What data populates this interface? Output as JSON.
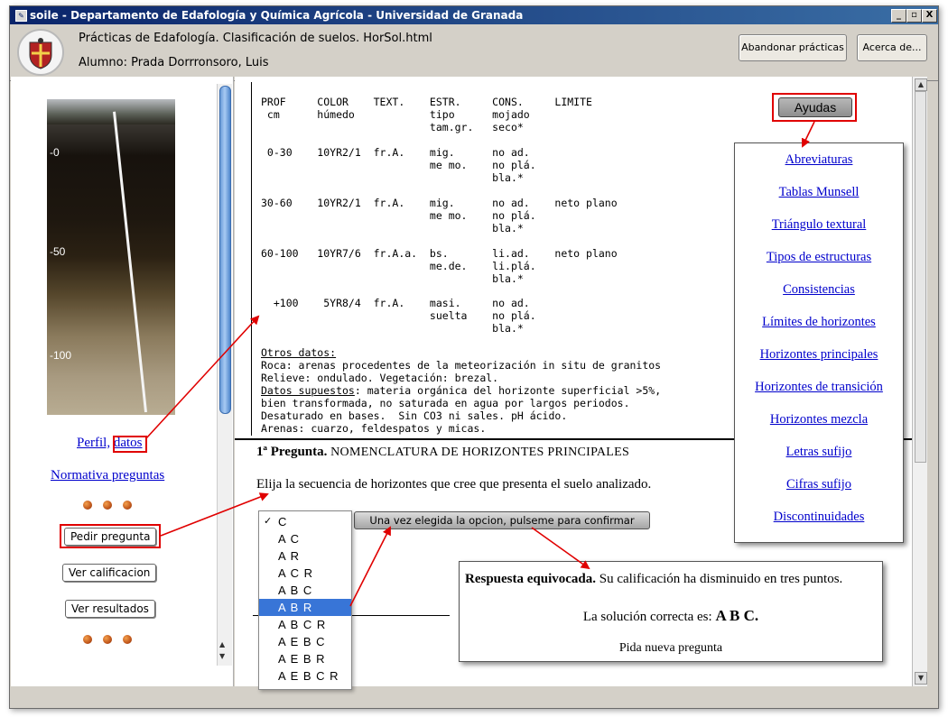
{
  "window": {
    "title": "soile - Departamento de Edafología y Química Agrícola - Universidad de Granada",
    "controls": [
      "_",
      "▫",
      "X"
    ]
  },
  "header": {
    "title": "Prácticas de Edafología. Clasificación de suelos. HorSol.html",
    "student": "Alumno: Prada Dorrronsoro, Luis",
    "buttons": {
      "quit": "Abandonar prácticas",
      "about": "Acerca de..."
    }
  },
  "left": {
    "depth_labels": [
      "-0",
      "-50",
      "-100"
    ],
    "profile_link": "Perfil,",
    "data_link": "datos",
    "normativa_link": "Normativa preguntas",
    "buttons": {
      "ask": "Pedir pregunta",
      "grade": "Ver calificacion",
      "results": "Ver resultados"
    }
  },
  "table": {
    "header_lines": [
      "PROF     COLOR    TEXT.    ESTR.     CONS.     LIMITE",
      " cm      húmedo            tipo      mojado",
      "                           tam.gr.   seco*"
    ],
    "rows": [
      [
        " 0-30    10YR2/1  fr.A.    mig.      no ad.",
        "                           me mo.    no plá.",
        "                                     bla.*"
      ],
      [
        "30-60    10YR2/1  fr.A.    mig.      no ad.    neto plano",
        "                           me mo.    no plá.",
        "                                     bla.*"
      ],
      [
        "60-100   10YR7/6  fr.A.a.  bs.       li.ad.    neto plano",
        "                           me.de.    li.plá.",
        "                                     bla.*"
      ],
      [
        "  +100    5YR8/4  fr.A.    masi.     no ad.",
        "                           suelta    no plá.",
        "                                     bla.*"
      ]
    ]
  },
  "other_data": {
    "heading": "Otros datos:",
    "lines": [
      "Roca: arenas procedentes de la meteorización in situ de granitos",
      "Relieve: ondulado. Vegetación: brezal."
    ],
    "assumed_label": "Datos supuestos",
    "assumed_text": ": materia orgánica del horizonte superficial >5%,",
    "more_lines": [
      "bien transformada, no saturada en agua por largos periodos.",
      "Desaturado en bases.  Sin CO3 ni sales. pH ácido.",
      "Arenas: cuarzo, feldespatos y micas."
    ]
  },
  "help": {
    "button": "Ayudas",
    "links": [
      "Abreviaturas",
      "Tablas Munsell",
      "Triángulo textural",
      "Tipos de estructuras",
      "Consistencias",
      "Límites de horizontes",
      "Horizontes principales ",
      "Horizontes de transición",
      "Horizontes mezcla",
      "Letras sufijo",
      "Cifras sufijo",
      "Discontinuidades"
    ]
  },
  "question": {
    "number": "1ª Pregunta.",
    "title": "NOMENCLATURA DE HORIZONTES PRINCIPALES",
    "prompt": "Elija la secuencia de horizontes que cree que presenta el suelo analizado.",
    "options": [
      "C",
      "A C",
      "A R",
      "A C R",
      "A B C",
      "A B R",
      "A B C R",
      "A E B C",
      "A E B R",
      "A E B C R"
    ],
    "selected_index": 5,
    "checked_index": 0,
    "confirm_button": "Una vez elegida la opcion, pulseme para confirmar"
  },
  "result": {
    "headline": "Respuesta equivocada.",
    "message": "Su calificación ha disminuido en tres puntos.",
    "solution_label": "La solución correcta es:",
    "solution_value": "A B C.",
    "next": "Pida nueva pregunta"
  },
  "colors": {
    "title_bar": "#0a246a",
    "link": "#0000cc",
    "highlight": "#e00000",
    "selection": "#3875d7"
  }
}
